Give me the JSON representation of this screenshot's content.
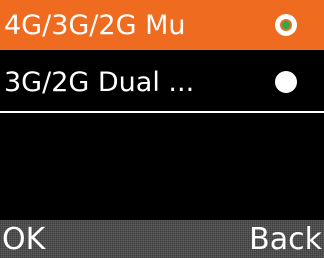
{
  "menu": {
    "options": [
      {
        "label": "4G/3G/2G Mu",
        "selected": true
      },
      {
        "label": "3G/2G Dual ...",
        "selected": false
      }
    ]
  },
  "softkeys": {
    "left": "OK",
    "right": "Back"
  },
  "colors": {
    "highlight": "#ee6b1f",
    "background": "#000000",
    "softkey_bar": "#5e5e5e",
    "radio_checked": "#2ea84a"
  },
  "icons": {
    "radio_checked": "radio-checked-icon",
    "radio_unchecked": "radio-unchecked-icon"
  }
}
